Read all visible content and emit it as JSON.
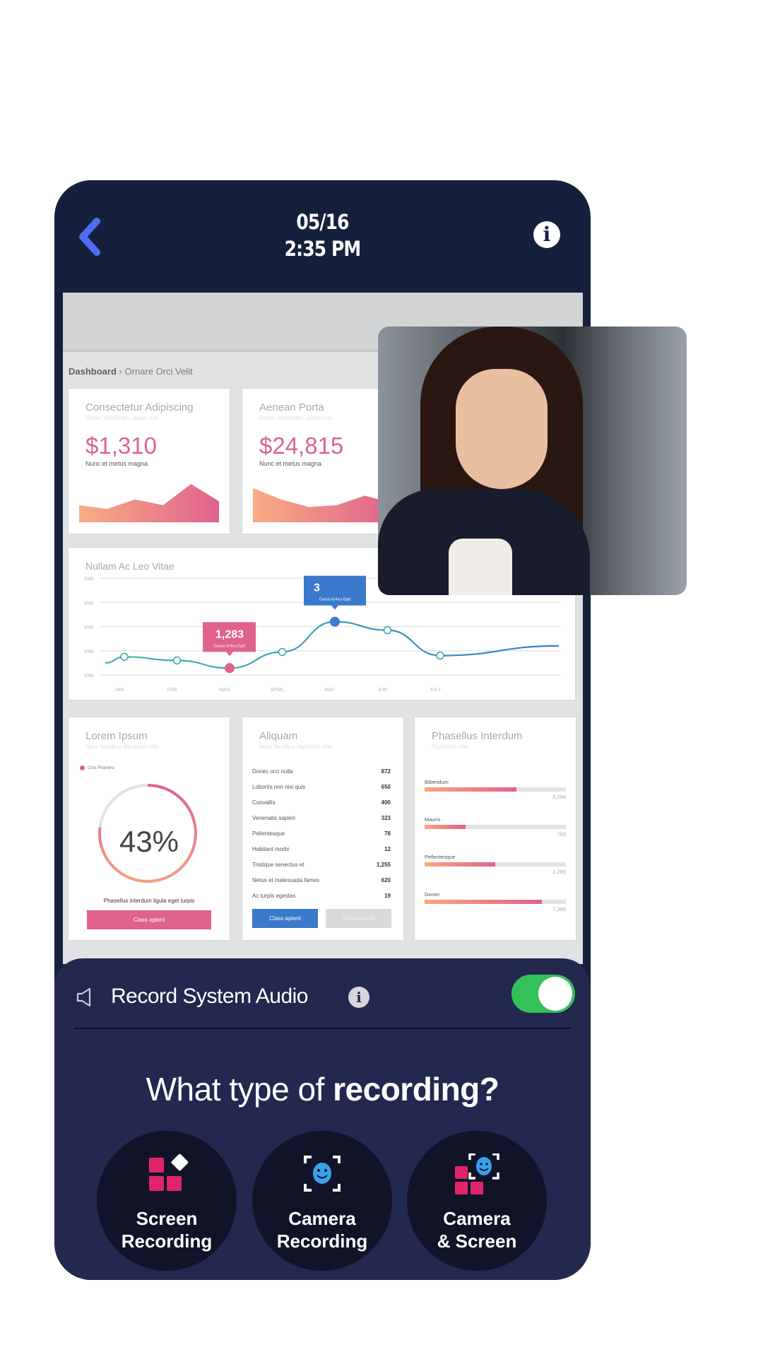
{
  "header": {
    "date": "05/16",
    "time": "2:35 PM",
    "back_icon": "chevron-left-icon",
    "info_icon": "info-icon"
  },
  "dashboard": {
    "breadcrumb": {
      "root": "Dashboard",
      "separator": "›",
      "current": "Ornare Orci Velit"
    },
    "kpi_cards": [
      {
        "title": "Consectetur Adipiscing",
        "subtitle": "Donec sollicitudin, ipsum non",
        "value": "$1,310",
        "caption": "Nunc et metus magna",
        "trend": [
          0.45,
          0.35,
          0.6,
          0.45,
          1.0,
          0.55
        ]
      },
      {
        "title": "Aenean Porta",
        "subtitle": "Donec sollicitudin, ipsum non",
        "value": "$24,815",
        "caption": "Nunc et metus magna",
        "trend": [
          0.9,
          0.6,
          0.4,
          0.45,
          0.7,
          0.5
        ]
      }
    ],
    "line_card": {
      "title": "Nullam Ac Leo Vitae",
      "tooltip_pink": {
        "value": "1,283",
        "caption": "Cursus Id Arcu Eget"
      },
      "tooltip_blue": {
        "value": "3",
        "caption": "Cursus Id Arcu Eget"
      }
    },
    "donut_card": {
      "title": "Lorem Ipsum",
      "subtitle": "Nunc faucibus dignissim nibh",
      "legend": "Cras Pharetra",
      "percent": 43,
      "percent_label": "43%",
      "caption": "Phasellus interdum ligula eget turpis",
      "button": "Class aptent"
    },
    "list_card": {
      "title": "Aliquam",
      "subtitle": "Nunc faucibus dignissim nibh",
      "rows": [
        {
          "label": "Donec orci nulla",
          "value": "872"
        },
        {
          "label": "Lobortis non nisi quis",
          "value": "650"
        },
        {
          "label": "Convallis",
          "value": "400"
        },
        {
          "label": "Venenatis sapien",
          "value": "323"
        },
        {
          "label": "Pellentesque",
          "value": "78"
        },
        {
          "label": "Habitant morbi",
          "value": "12"
        },
        {
          "label": "Tristique senectus et",
          "value": "1,255"
        },
        {
          "label": "Netus et malesuada fames",
          "value": "620"
        },
        {
          "label": "Ac turpis egestas",
          "value": "19"
        }
      ],
      "primary_button": "Class aptent",
      "secondary_button": "Class aptent"
    },
    "bars_card": {
      "title": "Phasellus Interdum",
      "subtitle": "Dignissim nibh",
      "bars": [
        {
          "label": "Bibendum",
          "value": "5,298",
          "fraction": 0.65
        },
        {
          "label": "Mauris",
          "value": "765",
          "fraction": 0.29
        },
        {
          "label": "Pellentesque",
          "value": "1,285",
          "fraction": 0.5
        },
        {
          "label": "Donec",
          "value": "7,366",
          "fraction": 0.83
        }
      ]
    }
  },
  "chart_data": {
    "type": "line",
    "title": "Nullam Ac Leo Vitae",
    "categories": [
      "JAN",
      "FEB",
      "MAR",
      "APRIL",
      "MAY",
      "JUN",
      "JULY"
    ],
    "series": [
      {
        "name": "Cursus Id Arcu Eget",
        "values": [
          1750,
          1600,
          1283,
          1950,
          3200,
          2850,
          1800
        ]
      }
    ],
    "yticks": [
      "1000",
      "2000",
      "3000",
      "4000",
      "5000"
    ],
    "ylim": [
      1000,
      5000
    ],
    "highlighted": [
      {
        "category": "MAR",
        "value": 1283,
        "color": "#e0628c"
      },
      {
        "category": "MAY",
        "value": 3200,
        "color": "#3b79cc"
      }
    ],
    "grid": true
  },
  "camera_overlay": {
    "description": "camera-feed-person"
  },
  "audio": {
    "label": "Record System Audio",
    "enabled": true,
    "speaker_icon": "speaker-icon",
    "info_icon": "info-icon"
  },
  "recording": {
    "question_prefix": "What type of ",
    "question_bold": "recording?",
    "options": [
      {
        "line1": "Screen",
        "line2": "Recording",
        "icon": "screen-grid-icon"
      },
      {
        "line1": "Camera",
        "line2": "Recording",
        "icon": "face-camera-icon"
      },
      {
        "line1": "Camera",
        "line2": "& Screen",
        "icon": "camera-screen-icon"
      }
    ]
  },
  "colors": {
    "frame": "#15203d",
    "panel": "#22284e",
    "accent_pink": "#e0628c",
    "accent_blue": "#3b79cc",
    "toggle_on": "#35c15a",
    "back_arrow": "#4f6cf2"
  }
}
